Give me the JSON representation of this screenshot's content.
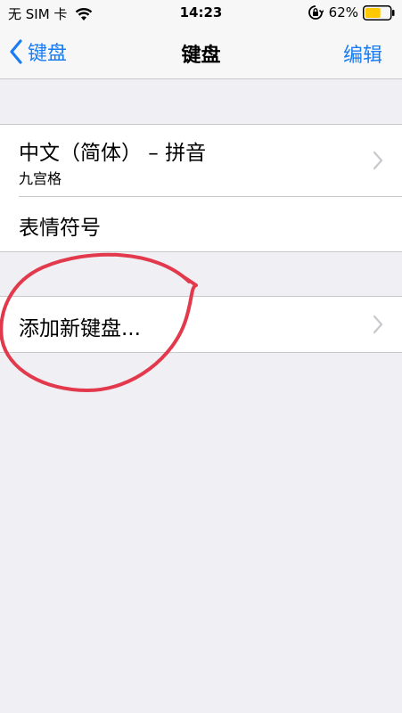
{
  "status_bar": {
    "carrier": "无 SIM 卡",
    "time": "14:23",
    "battery": "62%",
    "battery_level": 0.62
  },
  "nav": {
    "back_label": "键盘",
    "title": "键盘",
    "edit_label": "编辑"
  },
  "keyboards": [
    {
      "title": "中文（简体） – 拼音",
      "subtitle": "九宫格"
    },
    {
      "title": "表情符号"
    }
  ],
  "add_keyboard": {
    "label": "添加新键盘..."
  },
  "colors": {
    "accent": "#1a7cf2",
    "annotation": "#e23a4c",
    "battery_fill": "#ffc800"
  }
}
